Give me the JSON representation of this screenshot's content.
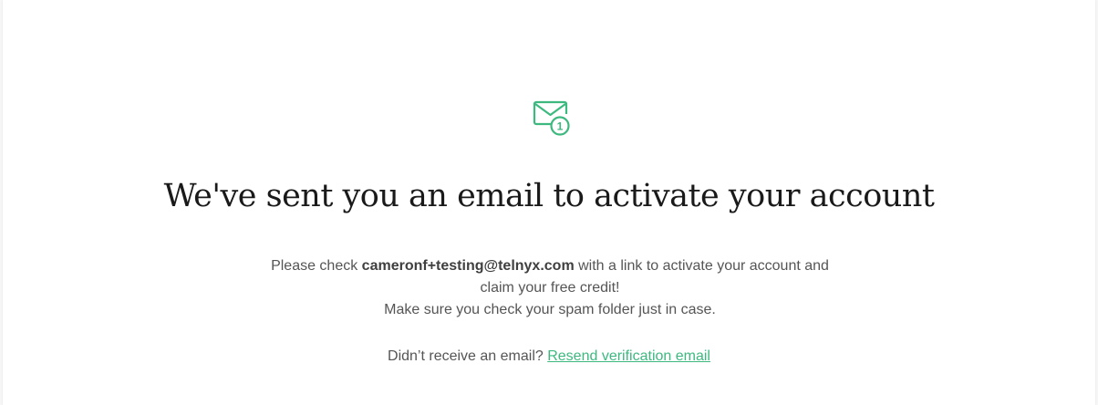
{
  "colors": {
    "accent": "#3db97f",
    "title": "#1a1a1a",
    "body_text": "#555555"
  },
  "icon": "mail-notification-icon",
  "icon_badge": "1",
  "title": "We've sent you an email to activate your account",
  "message": {
    "prefix": "Please check ",
    "email": "cameronf+testing@telnyx.com",
    "suffix": " with a link to activate your account and claim your free credit!",
    "spam_note": "Make sure you check your spam folder just in case."
  },
  "resend": {
    "prompt": "Didn’t receive an email? ",
    "link_label": "Resend verification email"
  }
}
